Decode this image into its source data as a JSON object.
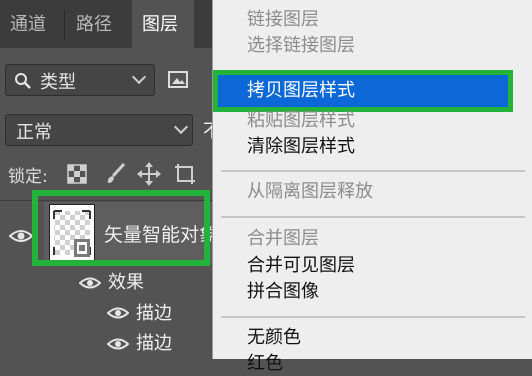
{
  "tabs": [
    {
      "label": "通道"
    },
    {
      "label": "路径"
    },
    {
      "label": "图层"
    }
  ],
  "filter": {
    "value": "类型"
  },
  "blend_mode": {
    "value": "正常",
    "next_label": "不"
  },
  "lock": {
    "label": "锁定:"
  },
  "layer": {
    "name": "矢量智能对象",
    "effects_label": "效果",
    "effects": [
      {
        "label": "描边"
      },
      {
        "label": "描边"
      }
    ]
  },
  "menu": {
    "items": [
      {
        "label": "链接图层",
        "enabled": false
      },
      {
        "label": "选择链接图层",
        "enabled": false
      },
      {
        "label": "拷贝图层样式",
        "enabled": true,
        "highlighted": true
      },
      {
        "label": "粘贴图层样式",
        "enabled": false
      },
      {
        "label": "清除图层样式",
        "enabled": true
      },
      {
        "label": "从隔离图层释放",
        "enabled": false
      },
      {
        "label": "合并图层",
        "enabled": false
      },
      {
        "label": "合并可见图层",
        "enabled": true
      },
      {
        "label": "拼合图像",
        "enabled": true
      },
      {
        "label": "无颜色",
        "enabled": true
      },
      {
        "label": "红色",
        "enabled": true
      }
    ]
  },
  "colors": {
    "highlight_fill": "#0b68d6",
    "annotation_green": "#23b33b",
    "panel_bg": "#535353",
    "menu_bg": "#eeeeee"
  }
}
